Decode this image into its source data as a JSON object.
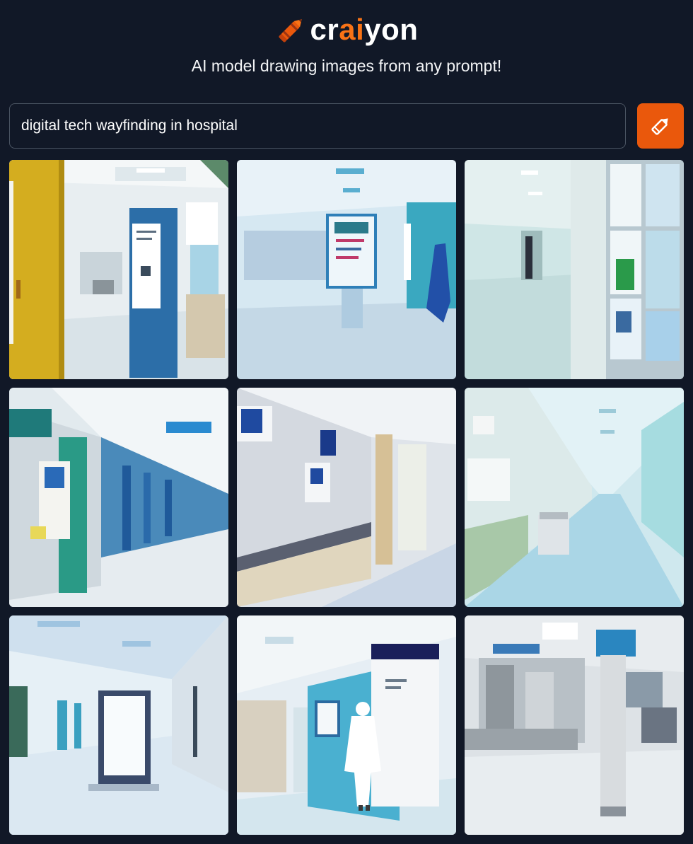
{
  "header": {
    "logo_prefix": "cr",
    "logo_accent": "ai",
    "logo_suffix": "yon",
    "tagline": "AI model drawing images from any prompt!"
  },
  "search": {
    "value": "digital tech wayfinding in hospital",
    "button_icon": "pencil-icon"
  },
  "colors": {
    "background": "#111827",
    "accent": "#ea580c",
    "logo_accent": "#f97316"
  },
  "results": {
    "count": 9,
    "images": [
      "image-1",
      "image-2",
      "image-3",
      "image-4",
      "image-5",
      "image-6",
      "image-7",
      "image-8",
      "image-9"
    ]
  }
}
